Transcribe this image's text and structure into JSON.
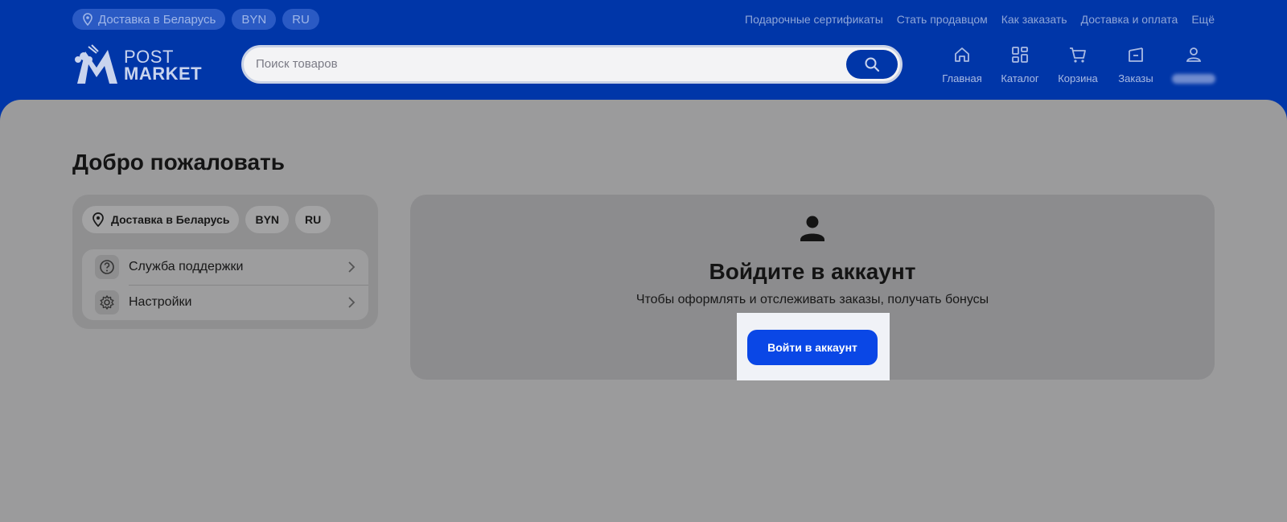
{
  "header": {
    "delivery": "Доставка в Беларусь",
    "currency": "BYN",
    "language": "RU",
    "top_links": [
      "Подарочные сертификаты",
      "Стать продавцом",
      "Как заказать",
      "Доставка и оплата",
      "Ещё"
    ],
    "logo": {
      "line1": "POST",
      "line2": "MARKET"
    },
    "search": {
      "placeholder": "Поиск товаров"
    },
    "nav": [
      {
        "label": "Главная",
        "icon": "home-icon"
      },
      {
        "label": "Каталог",
        "icon": "catalog-icon"
      },
      {
        "label": "Корзина",
        "icon": "cart-icon"
      },
      {
        "label": "Заказы",
        "icon": "orders-icon"
      },
      {
        "label": "",
        "icon": "user-icon"
      }
    ]
  },
  "main": {
    "title": "Добро пожаловать",
    "sidebar": {
      "delivery": "Доставка в Беларусь",
      "currency": "BYN",
      "language": "RU",
      "menu": [
        {
          "label": "Служба поддержки",
          "icon": "question-icon"
        },
        {
          "label": "Настройки",
          "icon": "gear-icon"
        }
      ]
    },
    "login": {
      "title": "Войдите в аккаунт",
      "subtitle": "Чтобы оформлять и отслеживать заказы, получать бонусы",
      "button": "Войти в аккаунт"
    }
  },
  "colors": {
    "brand": "#0036a8",
    "button": "#0a47e6",
    "overlay": "#9b9b9c"
  }
}
